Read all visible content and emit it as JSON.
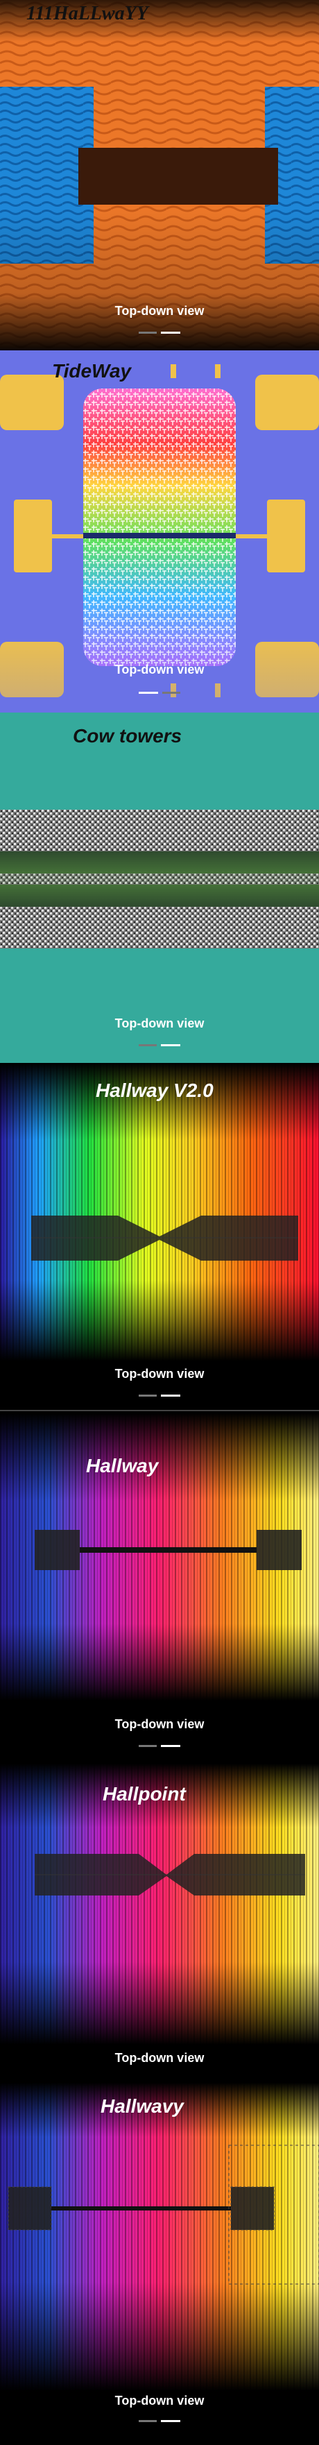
{
  "cards": [
    {
      "title": "111HaLLwaYY",
      "caption": "Top-down view",
      "active_dot": 2
    },
    {
      "title": "TideWay",
      "caption": "Top-down view",
      "active_dot": 1
    },
    {
      "title": "Cow towers",
      "caption": "Top-down view",
      "active_dot": 2
    },
    {
      "title": "Hallway V2.0",
      "caption": "Top-down view",
      "active_dot": 2
    },
    {
      "title": "Hallway",
      "caption": "Top-down view",
      "active_dot": 2
    },
    {
      "title": "Hallpoint",
      "caption": "Top-down view",
      "active_dot": 2
    },
    {
      "title": "Hallwavy",
      "caption": "Top-down view",
      "active_dot": 2
    }
  ],
  "colors": {
    "orange": "#e8742a",
    "blue": "#1f8ad6",
    "periwinkle": "#6b73e8",
    "teal": "#35aa9c",
    "gold": "#f0c24a"
  }
}
